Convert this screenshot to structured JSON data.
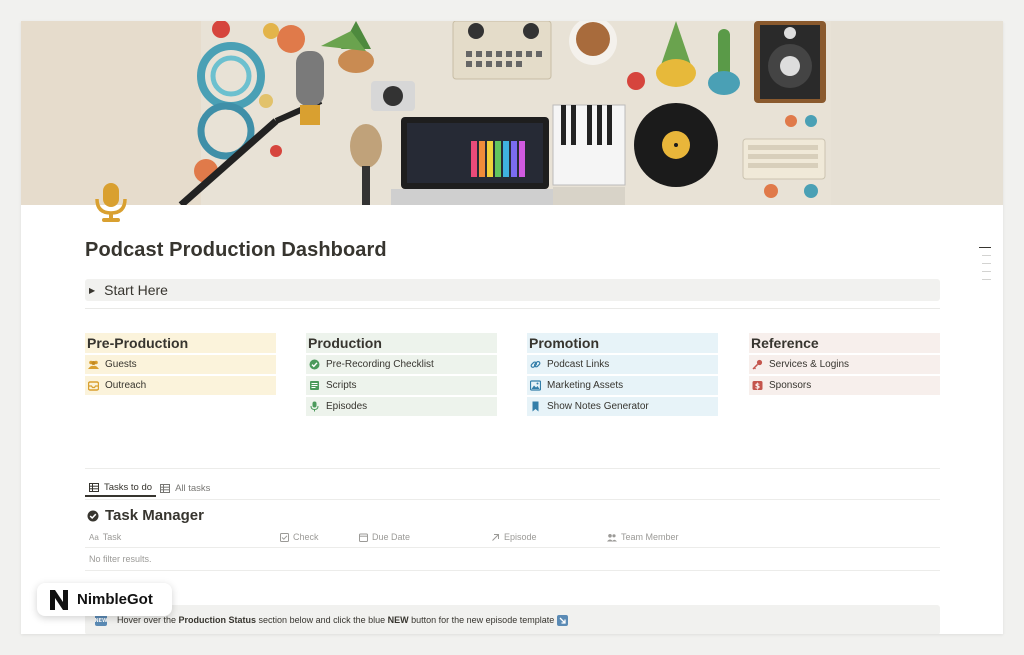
{
  "page": {
    "title": "Podcast Production Dashboard",
    "icon": "microphone-icon",
    "cover": "podcast-gear-flatlay"
  },
  "toggle": {
    "label": "Start Here"
  },
  "sections": [
    {
      "heading": "Pre-Production",
      "color": "#fbf3db",
      "items": [
        {
          "label": "Guests",
          "icon": "people-icon"
        },
        {
          "label": "Outreach",
          "icon": "inbox-icon"
        }
      ]
    },
    {
      "heading": "Production",
      "color": "#edf3ec",
      "items": [
        {
          "label": "Pre-Recording Checklist",
          "icon": "check-circle-icon"
        },
        {
          "label": "Scripts",
          "icon": "document-icon"
        },
        {
          "label": "Episodes",
          "icon": "microphone-icon"
        }
      ]
    },
    {
      "heading": "Promotion",
      "color": "#e7f3f8",
      "items": [
        {
          "label": "Podcast Links",
          "icon": "link-icon"
        },
        {
          "label": "Marketing Assets",
          "icon": "image-icon"
        },
        {
          "label": "Show Notes Generator",
          "icon": "bookmark-icon"
        }
      ]
    },
    {
      "heading": "Reference",
      "color": "#f7efec",
      "items": [
        {
          "label": "Services & Logins",
          "icon": "key-icon"
        },
        {
          "label": "Sponsors",
          "icon": "money-icon"
        }
      ]
    }
  ],
  "tasks": {
    "tabs": [
      {
        "label": "Tasks to do",
        "active": true
      },
      {
        "label": "All tasks",
        "active": false
      }
    ],
    "title": "Task Manager",
    "columns": [
      "Task",
      "Check",
      "Due Date",
      "Episode",
      "Team Member"
    ],
    "empty_text": "No filter results."
  },
  "callout": {
    "part1": "Hover over the ",
    "bold1": "Production Status",
    "part2": " section below and click the blue ",
    "bold2": "NEW",
    "part3": " button for the new episode template"
  },
  "brand": {
    "name": "NimbleGot"
  }
}
